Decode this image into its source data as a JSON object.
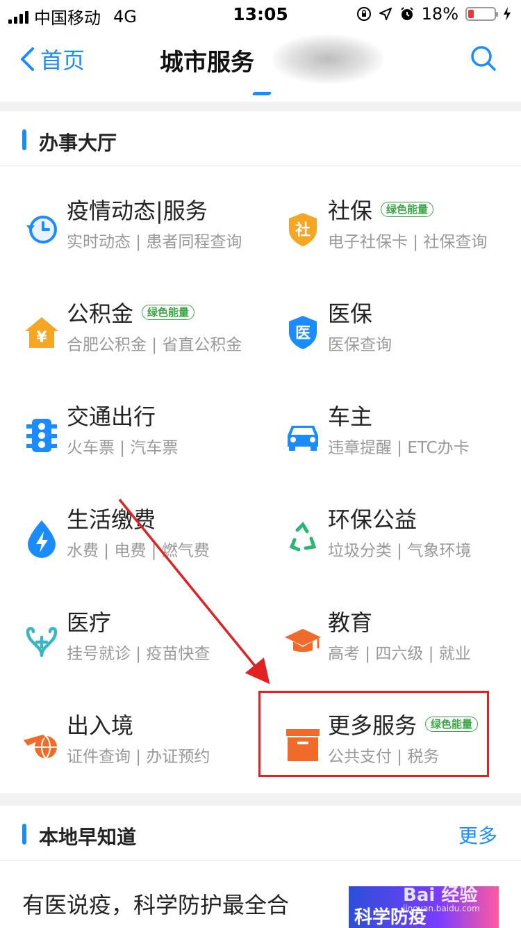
{
  "status": {
    "carrier": "中国移动",
    "network": "4G",
    "time": "13:05",
    "battery": "18%"
  },
  "nav": {
    "back_label": "首页",
    "title": "城市服务"
  },
  "hall": {
    "title": "办事大厅",
    "services": [
      {
        "name": "疫情动态|服务",
        "sub": "实时动态 | 患者同程查询",
        "badge": "",
        "icon": "clock-refresh-icon"
      },
      {
        "name": "社保",
        "sub": "电子社保卡 | 社保查询",
        "badge": "绿色能量",
        "icon": "social-security-shield-icon",
        "icon_char": "社"
      },
      {
        "name": "公积金",
        "sub": "合肥公积金 | 省直公积金",
        "badge": "绿色能量",
        "icon": "housing-fund-house-icon",
        "icon_char": "¥"
      },
      {
        "name": "医保",
        "sub": "医保查询",
        "badge": "",
        "icon": "medical-insurance-shield-icon",
        "icon_char": "医"
      },
      {
        "name": "交通出行",
        "sub": "火车票 | 汽车票",
        "badge": "",
        "icon": "traffic-light-icon"
      },
      {
        "name": "车主",
        "sub": "违章提醒 | ETC办卡",
        "badge": "",
        "icon": "car-icon"
      },
      {
        "name": "生活缴费",
        "sub": "水费 | 电费 | 燃气费",
        "badge": "",
        "icon": "lightning-drop-icon"
      },
      {
        "name": "环保公益",
        "sub": "垃圾分类 | 气象环境",
        "badge": "",
        "icon": "recycle-icon"
      },
      {
        "name": "医疗",
        "sub": "挂号就诊 | 疫苗快查",
        "badge": "",
        "icon": "stethoscope-icon"
      },
      {
        "name": "教育",
        "sub": "高考 | 四六级 | 就业",
        "badge": "",
        "icon": "graduation-cap-icon"
      },
      {
        "name": "出入境",
        "sub": "证件查询 | 办证预约",
        "badge": "",
        "icon": "plane-globe-icon"
      },
      {
        "name": "更多服务",
        "sub": "公共支付 | 税务",
        "badge": "绿色能量",
        "icon": "box-icon"
      }
    ]
  },
  "local": {
    "title": "本地早知道",
    "more": "更多",
    "news_title": "有医说疫，科学防护最全合",
    "thumb_text": "科学防疫"
  },
  "watermark": {
    "main": "Bai 经验",
    "sub": "jingyan.baidu.com"
  },
  "colors": {
    "accent": "#1a8cff",
    "orange": "#f5a623",
    "red_orange": "#f06a2a",
    "green_badge": "#3aa644",
    "annotation_red": "#e02222"
  }
}
